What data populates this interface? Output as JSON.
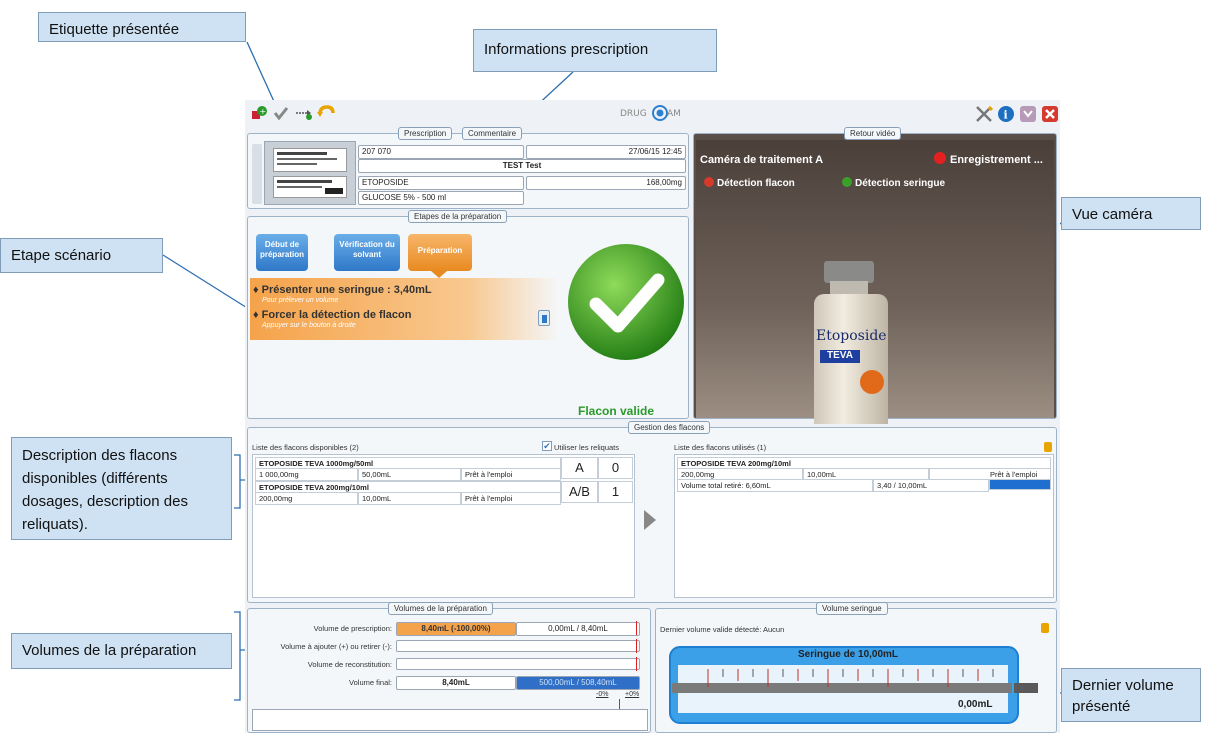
{
  "callouts": {
    "etiquette": "Etiquette présentée",
    "informations": "Informations prescription",
    "etape": "Etape scénario",
    "vue": "Vue caméra",
    "description": "Description des flacons disponibles (différents dosages, description des reliquats).",
    "volumes": "Volumes de la préparation",
    "dernier": "Dernier volume présenté"
  },
  "logo": "DRUG CAM",
  "prescription": {
    "tab1": "Prescription",
    "tab2": "Commentaire",
    "patient_id": "207 070",
    "datetime": "27/06/15 12:45",
    "patient_name": "TEST Test",
    "drug": "ETOPOSIDE",
    "dose": "168,00mg",
    "solvent": "GLUCOSE 5% - 500 ml"
  },
  "steps": {
    "title": "Etapes de la préparation",
    "s1": "Début de préparation",
    "s2": "Vérification du solvant",
    "s3": "Préparation",
    "instr1": "Présenter une seringue : 3,40mL",
    "instr1_sub": "Pour prélever un volume",
    "instr2": "Forcer la détection de flacon",
    "instr2_sub": "Appuyer sur le bouton à droite",
    "valid": "Flacon valide"
  },
  "video": {
    "title": "Retour vidéo",
    "camera": "Caméra de traitement A",
    "recording": "Enregistrement ...",
    "det_flacon": "Détection flacon",
    "det_seringue": "Détection seringue",
    "vial_brand": "Etoposide",
    "vial_maker": "TEVA"
  },
  "flacons": {
    "title": "Gestion des flacons",
    "available_title": "Liste des flacons disponibles (2)",
    "use_reliquats": "Utiliser les reliquats",
    "used_title": "Liste des flacons utilisés (1)",
    "available": [
      {
        "name": "ETOPOSIDE TEVA 1000mg/50ml",
        "dose": "1 000,00mg",
        "vol": "50,00mL",
        "status": "Prêt à l'emploi",
        "code": "A",
        "count": "0"
      },
      {
        "name": "ETOPOSIDE TEVA 200mg/10ml",
        "dose": "200,00mg",
        "vol": "10,00mL",
        "status": "Prêt à l'emploi",
        "code": "A/B",
        "count": "1"
      }
    ],
    "used": {
      "name": "ETOPOSIDE TEVA 200mg/10ml",
      "dose": "200,00mg",
      "vol": "10,00mL",
      "status": "Prêt à l'emploi",
      "removed": "Volume total retiré: 6,60mL",
      "ratio": "3,40 / 10,00mL"
    }
  },
  "volumes": {
    "title": "Volumes de la préparation",
    "presc_label": "Volume de prescription:",
    "presc_value": "8,40mL (-100,00%)",
    "presc_ratio": "0,00mL / 8,40mL",
    "add_label": "Volume à ajouter (+) ou retirer (-):",
    "recon_label": "Volume de reconstitution:",
    "final_label": "Volume final:",
    "final_value": "8,40mL",
    "final_ratio": "500,00mL / 508,40mL",
    "tol_minus": "-0%",
    "tol_plus": "+0%"
  },
  "syringe": {
    "title": "Volume seringue",
    "last_valid": "Dernier volume valide détecté: Aucun",
    "name": "Seringue de 10,00mL",
    "value": "0,00mL"
  }
}
